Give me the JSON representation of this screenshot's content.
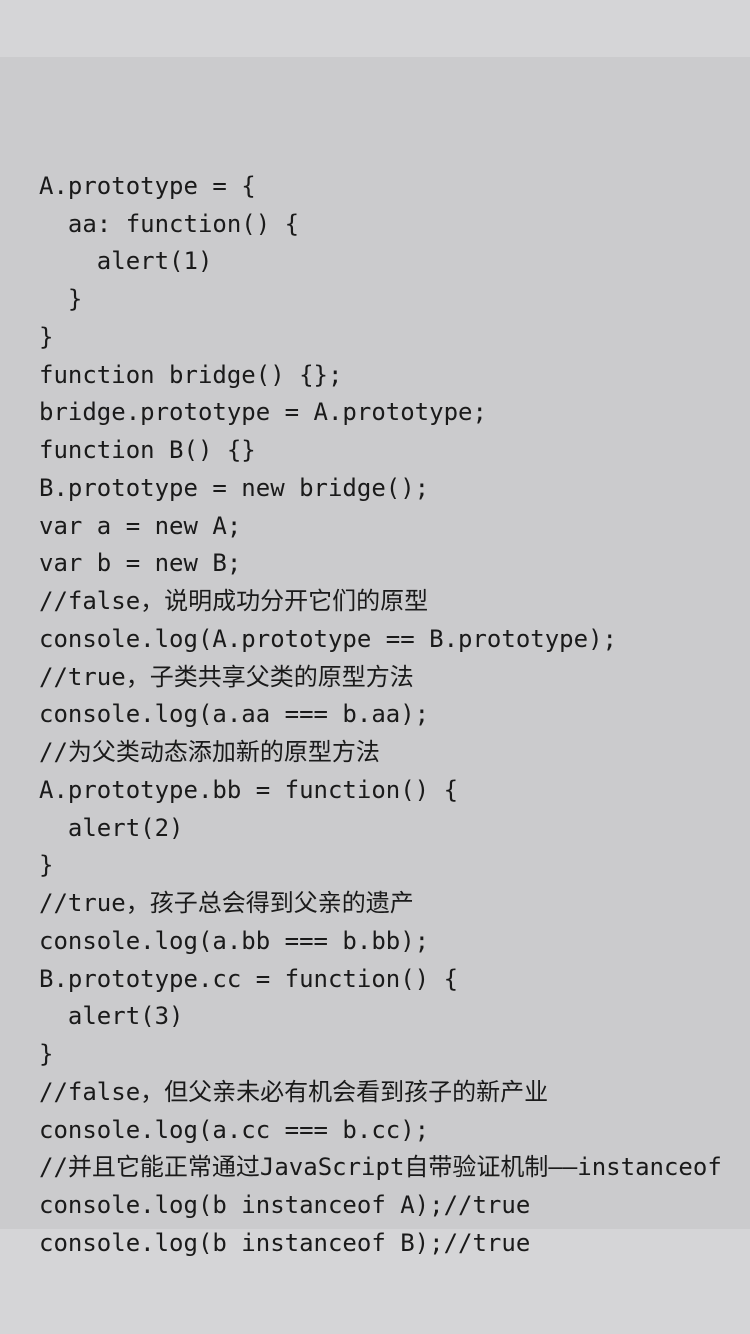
{
  "code": {
    "lines": [
      "A.prototype = {",
      "  aa: function() {",
      "    alert(1)",
      "  }",
      "}",
      "function bridge() {};",
      "bridge.prototype = A.prototype;",
      "function B() {}",
      "B.prototype = new bridge();",
      "var a = new A;",
      "var b = new B;",
      "//false，说明成功分开它们的原型",
      "console.log(A.prototype == B.prototype);",
      "//true，子类共享父类的原型方法",
      "console.log(a.aa === b.aa);",
      "//为父类动态添加新的原型方法",
      "A.prototype.bb = function() {",
      "  alert(2)",
      "}",
      "//true，孩子总会得到父亲的遗产",
      "console.log(a.bb === b.bb);",
      "B.prototype.cc = function() {",
      "  alert(3)",
      "}",
      "//false，但父亲未必有机会看到孩子的新产业",
      "console.log(a.cc === b.cc);",
      "//并且它能正常通过JavaScript自带验证机制——instanceof",
      "console.log(b instanceof A);//true",
      "console.log(b instanceof B);//true"
    ]
  }
}
